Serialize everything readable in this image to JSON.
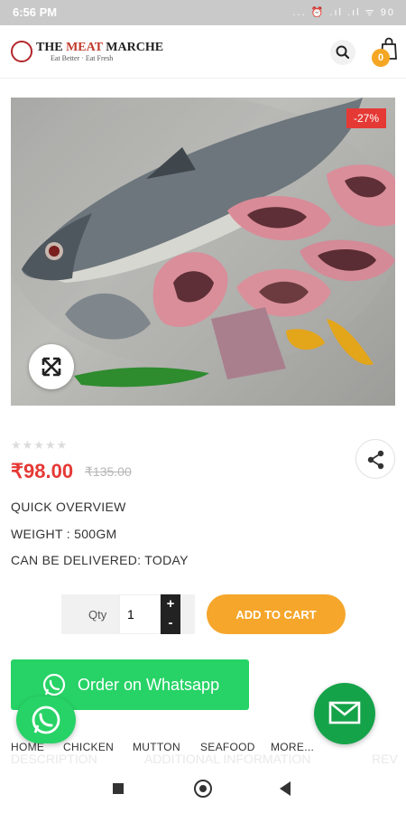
{
  "status_bar": {
    "time": "6:56 PM",
    "icons": "... ⏰ .ıl .ıl ᯤ 90"
  },
  "brand": {
    "name_part1": "THE ",
    "name_part2": "MEAT",
    "name_part3": " MARCHE",
    "tagline": "Eat Better · Eat Fresh"
  },
  "header": {
    "cart_count": "0"
  },
  "product": {
    "discount_badge": "-27%",
    "rating_stars": "★★★★★",
    "price": "₹98.00",
    "old_price": "₹135.00",
    "overview_title": "QUICK OVERVIEW",
    "weight": "WEIGHT : 500GM",
    "delivery": "CAN BE DELIVERED: TODAY"
  },
  "quantity": {
    "label": "Qty",
    "value": "1",
    "plus": "+",
    "minus": "-"
  },
  "buttons": {
    "add_to_cart": "ADD TO CART",
    "whatsapp_order": "Order on Whatsapp"
  },
  "tabs_ghost": {
    "tab1": "DESCRIPTION",
    "tab2": "ADDITIONAL INFORMATION",
    "tab3": "REV"
  },
  "bottom_nav": {
    "items": [
      "HOME",
      "CHICKEN",
      "MUTTON",
      "SEAFOOD",
      "MORE..."
    ]
  },
  "colors": {
    "price_red": "#e53935",
    "accent_orange": "#f5a62b",
    "whatsapp_green": "#27d366",
    "mail_green": "#15a34a"
  }
}
